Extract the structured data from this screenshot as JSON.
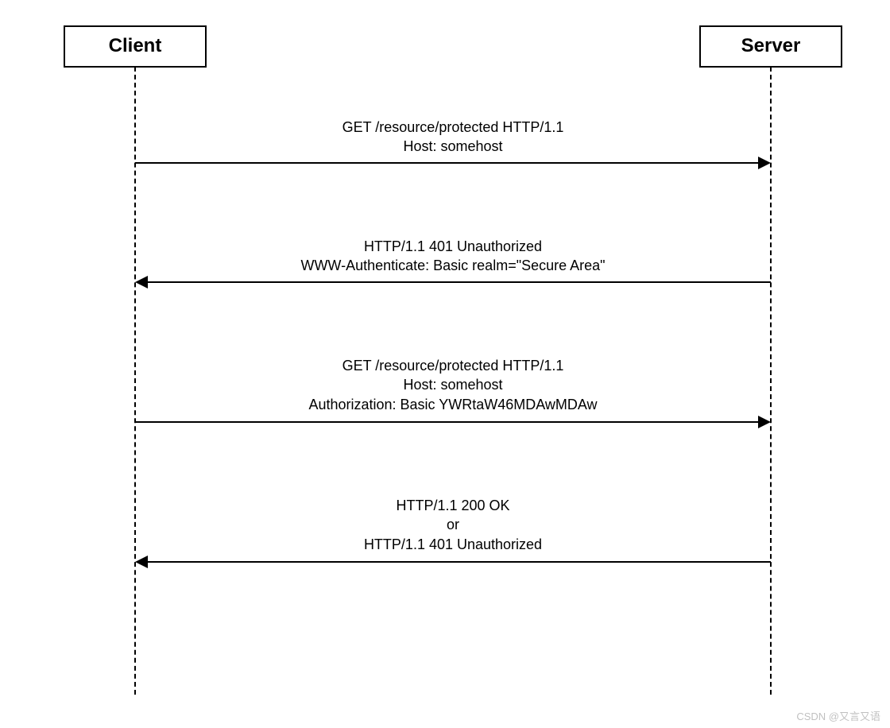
{
  "participants": {
    "client": "Client",
    "server": "Server"
  },
  "messages": {
    "m1": "GET /resource/protected HTTP/1.1\nHost: somehost",
    "m2": "HTTP/1.1 401 Unauthorized\nWWW-Authenticate: Basic realm=\"Secure Area\"",
    "m3": "GET /resource/protected HTTP/1.1\nHost: somehost\nAuthorization: Basic YWRtaW46MDAwMDAw",
    "m4": "HTTP/1.1 200 OK\nor\nHTTP/1.1 401 Unauthorized"
  },
  "watermark": "CSDN @又言又语"
}
